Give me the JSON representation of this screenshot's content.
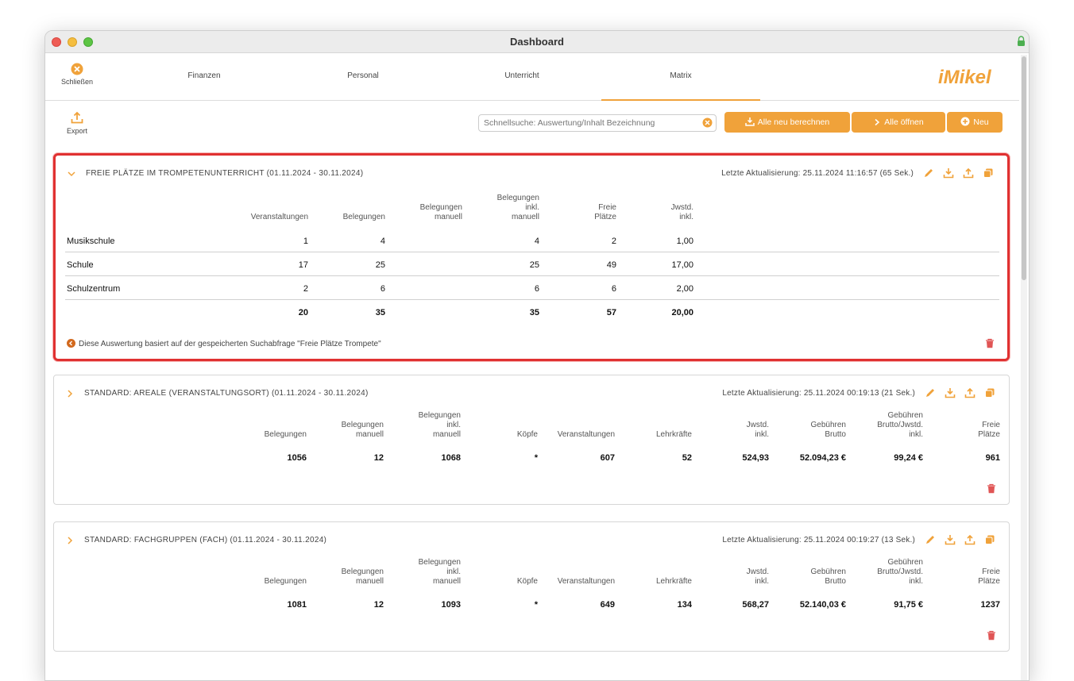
{
  "window": {
    "title": "Dashboard"
  },
  "nav": {
    "close_label": "Schließen",
    "tabs": [
      "Finanzen",
      "Personal",
      "Unterricht",
      "Matrix"
    ],
    "active_tab": "Matrix",
    "logo_text": "iMikel"
  },
  "toolbar": {
    "export_label": "Export",
    "search_placeholder": "Schnellsuche: Auswertung/Inhalt Bezeichnung",
    "btn_recalc": "Alle neu berechnen",
    "btn_open_all": "Alle öffnen",
    "btn_new": "Neu"
  },
  "colors": {
    "accent": "#f0a23a",
    "highlight": "#e03131",
    "trash": "#e05555"
  },
  "cards": [
    {
      "title": "FREIE PLÄTZE IM TROMPETENUNTERRICHT (01.11.2024 - 30.11.2024)",
      "updated": "Letzte Aktualisierung: 25.11.2024 11:16:57  (65 Sek.)",
      "expanded": true,
      "headers": [
        "Veranstaltungen",
        "Belegungen",
        "Belegungen\nmanuell",
        "Belegungen\ninkl.\nmanuell",
        "Freie\nPlätze",
        "Jwstd.\ninkl."
      ],
      "rows": [
        {
          "label": "Musikschule",
          "values": [
            "1",
            "4",
            "",
            "4",
            "2",
            "1,00"
          ]
        },
        {
          "label": "Schule",
          "values": [
            "17",
            "25",
            "",
            "25",
            "49",
            "17,00"
          ]
        },
        {
          "label": "Schulzentrum",
          "values": [
            "2",
            "6",
            "",
            "6",
            "6",
            "2,00"
          ]
        }
      ],
      "totals": [
        "20",
        "35",
        "",
        "35",
        "57",
        "20,00"
      ],
      "footnote": "Diese Auswertung basiert auf der gespeicherten Suchabfrage \"Freie Plätze Trompete\""
    },
    {
      "title": "STANDARD: AREALE (VERANSTALTUNGSORT) (01.11.2024 - 30.11.2024)",
      "updated": "Letzte Aktualisierung: 25.11.2024 00:19:13  (21 Sek.)",
      "expanded": false,
      "headers": [
        "Belegungen",
        "Belegungen\nmanuell",
        "Belegungen\ninkl.\nmanuell",
        "Köpfe",
        "Veranstaltungen",
        "Lehrkräfte",
        "Jwstd.\ninkl.",
        "Gebühren\nBrutto",
        "Gebühren\nBrutto/Jwstd.\ninkl.",
        "Freie\nPlätze"
      ],
      "totals": [
        "1056",
        "12",
        "1068",
        "*",
        "607",
        "52",
        "524,93",
        "52.094,23 €",
        "99,24 €",
        "961"
      ]
    },
    {
      "title": "STANDARD: FACHGRUPPEN (FACH) (01.11.2024 - 30.11.2024)",
      "updated": "Letzte Aktualisierung: 25.11.2024 00:19:27  (13 Sek.)",
      "expanded": false,
      "headers": [
        "Belegungen",
        "Belegungen\nmanuell",
        "Belegungen\ninkl.\nmanuell",
        "Köpfe",
        "Veranstaltungen",
        "Lehrkräfte",
        "Jwstd.\ninkl.",
        "Gebühren\nBrutto",
        "Gebühren\nBrutto/Jwstd.\ninkl.",
        "Freie\nPlätze"
      ],
      "totals": [
        "1081",
        "12",
        "1093",
        "*",
        "649",
        "134",
        "568,27",
        "52.140,03 €",
        "91,75 €",
        "1237"
      ]
    }
  ]
}
